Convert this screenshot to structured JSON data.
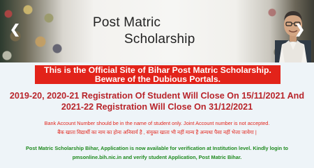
{
  "banner": {
    "title": "Post Matric",
    "subtitle": "Scholarship",
    "prev_arrow": "❮",
    "next_arrow": "❯"
  },
  "notice": {
    "line1": "This is the Official Site of Bihar Post Matric Scholarship.",
    "line2": "Beware of the Dubious Portals.",
    "background_color": "#e2231a"
  },
  "registration": {
    "line1": "2019-20, 2020-21 Registration Of Student Will Close On 15/11/2021 And",
    "line2": "2021-22 Registration Will Close On 31/12/2021"
  },
  "bank_note": {
    "english": "Bank Account Number should be in the name of student only. Joint Account number is not accepted.",
    "hindi": "बैंक खाता विद्यार्थी का नाम का होना अनिवार्य है , संयुक्त खाता भी नहीं मान्य है अन्यथा पैसा नहीं भेजा जायेगा |"
  },
  "application_note": {
    "line1": "Post Matric Scholarship Bihar, Application is now available for verification at Institution level. Kindly login to",
    "line2": "pmsonline.bih.nic.in and verify student Application, Post Matric Bihar."
  }
}
